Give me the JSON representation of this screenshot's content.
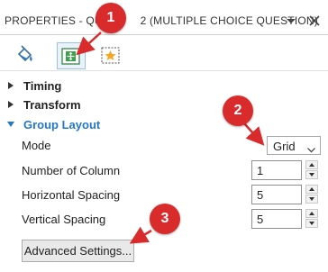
{
  "panel": {
    "title": "PROPERTIES - QUE",
    "title_rest": "2 (MULTIPLE CHOICE QUESTION)",
    "menu_icon": "dropdown-arrow-icon",
    "close_icon": "close-icon"
  },
  "tabs": [
    {
      "icon": "paint-bucket-icon",
      "active": false
    },
    {
      "icon": "group-layout-icon",
      "active": true
    },
    {
      "icon": "star-frame-icon",
      "active": false
    }
  ],
  "sections": {
    "timing": "Timing",
    "transform": "Transform",
    "group_layout": "Group Layout"
  },
  "group_layout": {
    "mode_label": "Mode",
    "mode_value": "Grid",
    "columns_label": "Number of Column",
    "columns_value": "1",
    "hspacing_label": "Horizontal Spacing",
    "hspacing_value": "5",
    "vspacing_label": "Vertical Spacing",
    "vspacing_value": "5",
    "advanced_button": "Advanced Settings..."
  },
  "callouts": [
    "1",
    "2",
    "3"
  ],
  "colors": {
    "accent": "#2378c8",
    "callout": "#d92b2b",
    "active_tab_border": "#9ac2e6"
  }
}
